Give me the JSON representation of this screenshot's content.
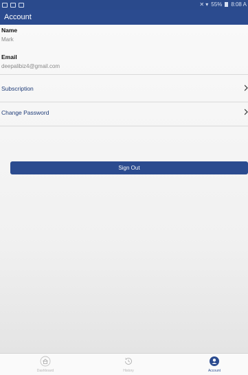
{
  "status_bar": {
    "battery": "55%",
    "time": "8:08 A"
  },
  "header": {
    "title": "Account"
  },
  "profile": {
    "name_label": "Name",
    "name_value": "Mark",
    "email_label": "Email",
    "email_value": "deepalibiz4@gmail.com"
  },
  "menu": {
    "subscription_label": "Subscription",
    "change_password_label": "Change Password"
  },
  "sign_out_label": "Sign Out",
  "bottom_nav": {
    "tabs": [
      {
        "label": "Dashboard",
        "icon": "home-icon",
        "active": false
      },
      {
        "label": "History",
        "icon": "history-icon",
        "active": false
      },
      {
        "label": "Account",
        "icon": "account-icon",
        "active": true
      }
    ]
  },
  "colors": {
    "primary": "#2b4b8f",
    "link": "#1f3c78"
  }
}
